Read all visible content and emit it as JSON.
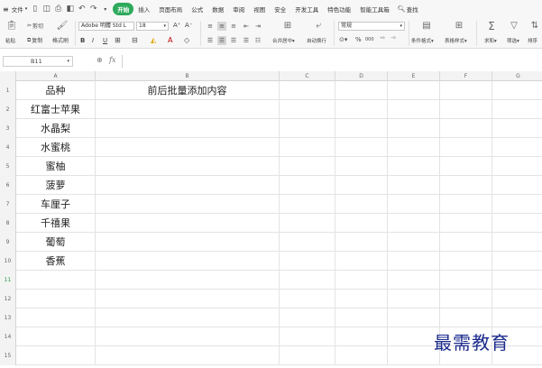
{
  "menu": {
    "file": "文件",
    "file_caret": "▾",
    "tabs": [
      {
        "label": "开始",
        "active": true
      },
      {
        "label": "插入",
        "active": false
      },
      {
        "label": "页面布局",
        "active": false
      },
      {
        "label": "公式",
        "active": false
      },
      {
        "label": "数据",
        "active": false
      },
      {
        "label": "审阅",
        "active": false
      },
      {
        "label": "视图",
        "active": false
      },
      {
        "label": "安全",
        "active": false
      },
      {
        "label": "开发工具",
        "active": false
      },
      {
        "label": "特色功能",
        "active": false
      },
      {
        "label": "智能工具箱",
        "active": false
      }
    ],
    "search": "查找"
  },
  "ribbon": {
    "paste": "粘贴",
    "cut": "剪切",
    "copy": "复制",
    "format_painter": "格式刷",
    "font_name": "Adobe 明體 Std L",
    "font_size": "18",
    "grow_font": "A⁺",
    "shrink_font": "A⁻",
    "merge_center": "合并居中",
    "wrap_text": "自动换行",
    "number_format": "常规",
    "percent": "%",
    "thousands": "000",
    "cond_format": "条件格式",
    "table_style": "表格样式",
    "sum": "求和",
    "filter": "筛选",
    "sort": "排序"
  },
  "formula_bar": {
    "cell_ref": "B11",
    "fx": "fx",
    "value": ""
  },
  "sheet": {
    "columns": [
      "A",
      "B",
      "C",
      "D",
      "E",
      "F",
      "G"
    ],
    "rows": [
      {
        "n": "1",
        "a": "品种",
        "b": "前后批量添加内容"
      },
      {
        "n": "2",
        "a": "红富士苹果",
        "b": ""
      },
      {
        "n": "3",
        "a": "水晶梨",
        "b": ""
      },
      {
        "n": "4",
        "a": "水蜜桃",
        "b": ""
      },
      {
        "n": "5",
        "a": "蜜柚",
        "b": ""
      },
      {
        "n": "6",
        "a": "菠萝",
        "b": ""
      },
      {
        "n": "7",
        "a": "车厘子",
        "b": ""
      },
      {
        "n": "8",
        "a": "千禧果",
        "b": ""
      },
      {
        "n": "9",
        "a": "葡萄",
        "b": ""
      },
      {
        "n": "10",
        "a": "香蕉",
        "b": ""
      },
      {
        "n": "11",
        "a": "",
        "b": ""
      },
      {
        "n": "12",
        "a": "",
        "b": ""
      },
      {
        "n": "13",
        "a": "",
        "b": ""
      },
      {
        "n": "14",
        "a": "",
        "b": ""
      },
      {
        "n": "15",
        "a": "",
        "b": ""
      }
    ],
    "selected_row": "11"
  },
  "watermark": "最需教育",
  "colors": {
    "accent": "#2eaa5c",
    "watermark": "#1b2a8c"
  }
}
